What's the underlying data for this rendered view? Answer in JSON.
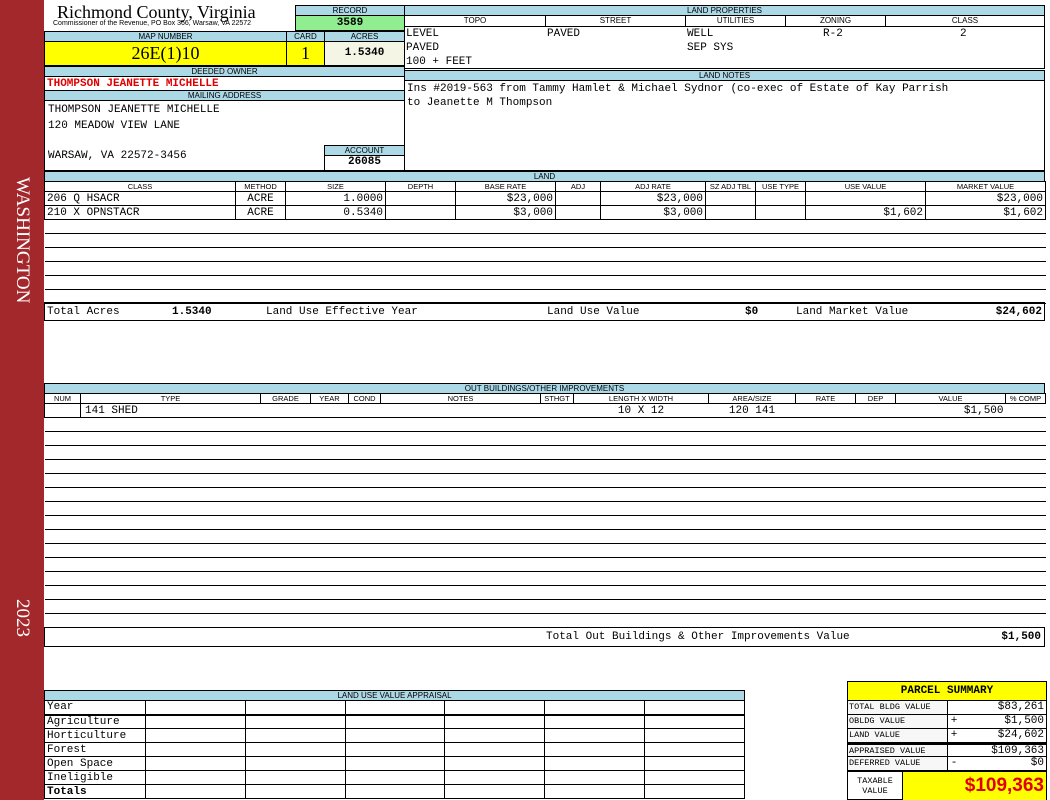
{
  "sidebar": {
    "district": "WASHINGTON",
    "year": "2023",
    "color": "#a3282c"
  },
  "header": {
    "county": "Richmond County, Virginia",
    "subtitle": "Commissioner of the Revenue, PO Box 366, Warsaw, VA 22572"
  },
  "record": {
    "label": "RECORD",
    "value": "3589"
  },
  "map": {
    "map_label": "MAP NUMBER",
    "map_value": "26E(1)10",
    "card_label": "CARD",
    "card_value": "1",
    "acres_label": "ACRES",
    "acres_value": "1.5340"
  },
  "owner": {
    "label": "DEEDED OWNER",
    "name": "THOMPSON JEANETTE MICHELLE"
  },
  "mailing": {
    "label": "MAILING ADDRESS",
    "line1": "THOMPSON JEANETTE MICHELLE",
    "line2": "120 MEADOW VIEW LANE",
    "line3": "WARSAW, VA 22572-3456"
  },
  "account": {
    "label": "ACCOUNT",
    "value": "26085"
  },
  "land_properties": {
    "title": "LAND PROPERTIES",
    "headers": [
      "TOPO",
      "STREET",
      "UTILITIES",
      "ZONING",
      "CLASS"
    ],
    "topo": [
      "LEVEL",
      "PAVED",
      "100 + FEET"
    ],
    "street": "PAVED",
    "utilities": [
      "WELL",
      "SEP SYS"
    ],
    "zoning": "R-2",
    "class": "2"
  },
  "land_notes": {
    "title": "LAND NOTES",
    "text": "Ins #2019-563 from Tammy Hamlet & Michael Sydnor (co-exec of Estate of Kay Parrish to Jeanette M Thompson"
  },
  "land": {
    "title": "LAND",
    "headers": [
      "CLASS",
      "METHOD",
      "SIZE",
      "DEPTH",
      "BASE RATE",
      "ADJ",
      "ADJ RATE",
      "SZ ADJ TBL",
      "USE TYPE",
      "USE VALUE",
      "MARKET VALUE"
    ],
    "rows": [
      [
        "206 Q HSACR",
        "ACRE",
        "1.0000",
        "",
        "$23,000",
        "",
        "$23,000",
        "",
        "",
        "",
        "$23,000"
      ],
      [
        "210 X OPNSTACR",
        "ACRE",
        "0.5340",
        "",
        "$3,000",
        "",
        "$3,000",
        "",
        "",
        "$1,602",
        "$1,602"
      ]
    ],
    "total_acres_label": "Total Acres",
    "total_acres": "1.5340",
    "effective_year_label": "Land Use Effective Year",
    "land_use_value_label": "Land Use Value",
    "land_use_value": "$0",
    "market_value_label": "Land Market Value",
    "market_value": "$24,602"
  },
  "outbuildings": {
    "title": "OUT BUILDINGS/OTHER IMPROVEMENTS",
    "headers": [
      "NUM",
      "TYPE",
      "GRADE",
      "YEAR",
      "COND",
      "NOTES",
      "STHGT",
      "LENGTH X WIDTH",
      "AREA/SIZE",
      "RATE",
      "DEP",
      "VALUE",
      "% COMP"
    ],
    "rows": [
      [
        "",
        "141 SHED",
        "",
        "",
        "",
        "",
        "",
        "10 X 12",
        "120 141",
        "",
        "",
        "$1,500",
        ""
      ]
    ],
    "total_label": "Total Out Buildings & Other Improvements Value",
    "total_value": "$1,500"
  },
  "land_use_appraisal": {
    "title": "LAND USE VALUE APPRAISAL",
    "year_label": "Year",
    "rows": [
      "Agriculture",
      "Horticulture",
      "Forest",
      "Open Space",
      "Ineligible"
    ],
    "totals_label": "Totals"
  },
  "summary": {
    "title": "PARCEL SUMMARY",
    "rows": [
      {
        "label": "TOTAL BLDG VALUE",
        "sign": "",
        "value": "$83,261"
      },
      {
        "label": "OBLDG VALUE",
        "sign": "+",
        "value": "$1,500"
      },
      {
        "label": "LAND VALUE",
        "sign": "+",
        "value": "$24,602"
      },
      {
        "label": "APPRAISED VALUE",
        "sign": "",
        "value": "$109,363"
      },
      {
        "label": "DEFERRED VALUE",
        "sign": "-",
        "value": "$0"
      }
    ],
    "taxable_label": "TAXABLE VALUE",
    "taxable_value": "$109,363"
  },
  "colors": {
    "header_blue": "#add8e6",
    "yellow": "#ffff00",
    "green": "#90ee90",
    "red": "#e00000"
  }
}
